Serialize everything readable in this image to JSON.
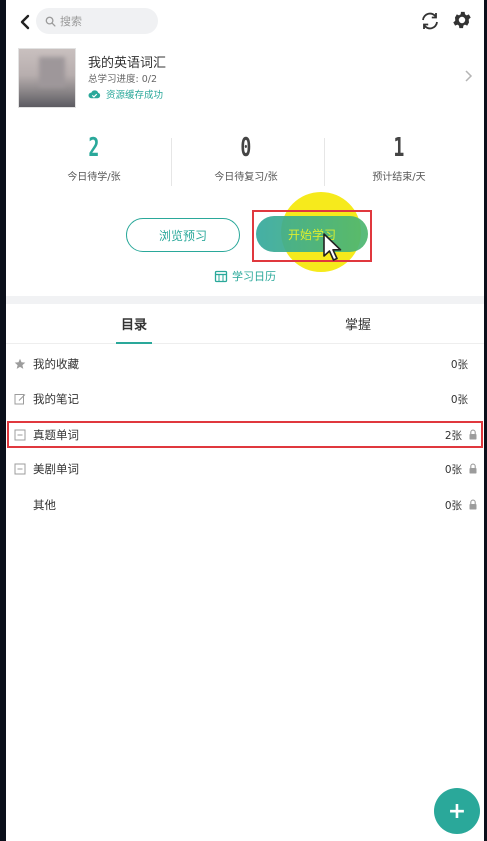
{
  "search": {
    "placeholder": "搜索"
  },
  "book": {
    "title": "我的英语词汇",
    "progress": "总学习进度: 0/2",
    "cache_status": "资源缓存成功"
  },
  "stats": [
    {
      "value": "2",
      "label": "今日待学/张"
    },
    {
      "value": "0",
      "label": "今日待复习/张"
    },
    {
      "value": "1",
      "label": "预计结束/天"
    }
  ],
  "actions": {
    "preview_label": "浏览预习",
    "start_label": "开始学习",
    "calendar_label": "学习日历"
  },
  "tabs": [
    {
      "label": "目录"
    },
    {
      "label": "掌握"
    }
  ],
  "list": [
    {
      "name": "我的收藏",
      "count": "0张",
      "icon": "star-icon",
      "locked": false
    },
    {
      "name": "我的笔记",
      "count": "0张",
      "icon": "note-icon",
      "locked": false
    },
    {
      "name": "真题单词",
      "count": "2张",
      "icon": "collapse-icon",
      "locked": true
    },
    {
      "name": "美剧单词",
      "count": "0张",
      "icon": "collapse-icon",
      "locked": true
    },
    {
      "name": "其他",
      "count": "0张",
      "icon": "",
      "locked": true
    }
  ],
  "colors": {
    "accent": "#2aa89a",
    "highlight_box": "#e0383e",
    "cursor_halo": "#f6ea1c"
  },
  "fab": {
    "label": "+"
  }
}
